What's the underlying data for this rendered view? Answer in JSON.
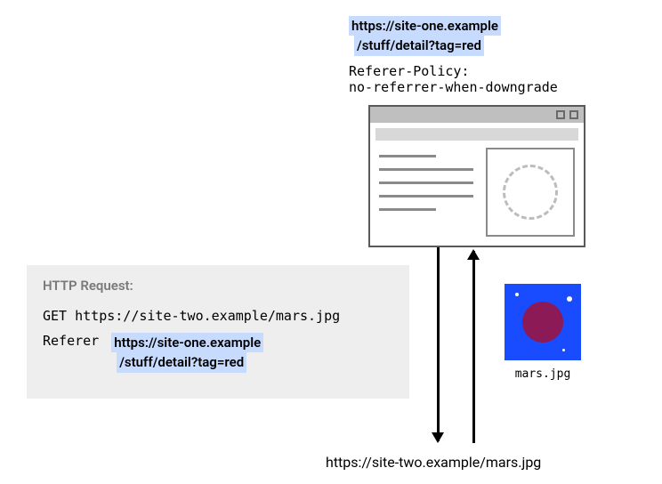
{
  "top_url": {
    "line1": "https://site-one.example",
    "line2": "/stuff/detail?tag=red"
  },
  "policy": {
    "line1": "Referer-Policy:",
    "line2": "no-referrer-when-downgrade"
  },
  "request": {
    "title": "HTTP Request:",
    "get_line": "GET https://site-two.example/mars.jpg",
    "referer_label": "Referer",
    "referer_url": {
      "line1": "https://site-one.example",
      "line2": "/stuff/detail?tag=red"
    }
  },
  "thumb": {
    "filename": "mars.jpg"
  },
  "bottom_url": "https://site-two.example/mars.jpg"
}
